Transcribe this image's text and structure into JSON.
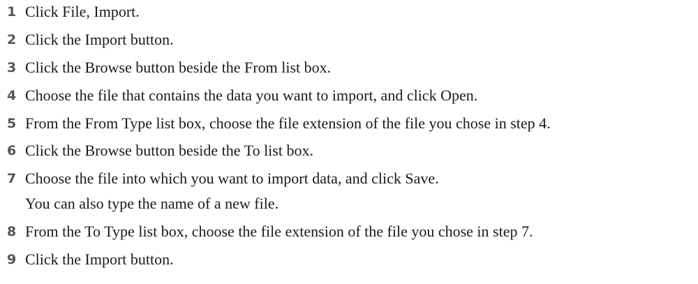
{
  "steps": [
    {
      "number": "1",
      "text": "Click File, Import."
    },
    {
      "number": "2",
      "text": "Click the Import button."
    },
    {
      "number": "3",
      "text": "Click the Browse button beside the From list box."
    },
    {
      "number": "4",
      "text": "Choose the file that contains the data you want to import, and click Open."
    },
    {
      "number": "5",
      "text": "From the From Type list box, choose the file extension of the file you chose in step 4."
    },
    {
      "number": "6",
      "text": "Click the Browse button beside the To list box."
    },
    {
      "number": "7",
      "text": "Choose the file into which you want to import data, and click Save."
    },
    {
      "number": "8",
      "text": "From the To Type list box, choose the file extension of the file you chose in step 7."
    },
    {
      "number": "9",
      "text": "Click the Import button."
    }
  ],
  "step7_note": "You can also type the name of a new file."
}
